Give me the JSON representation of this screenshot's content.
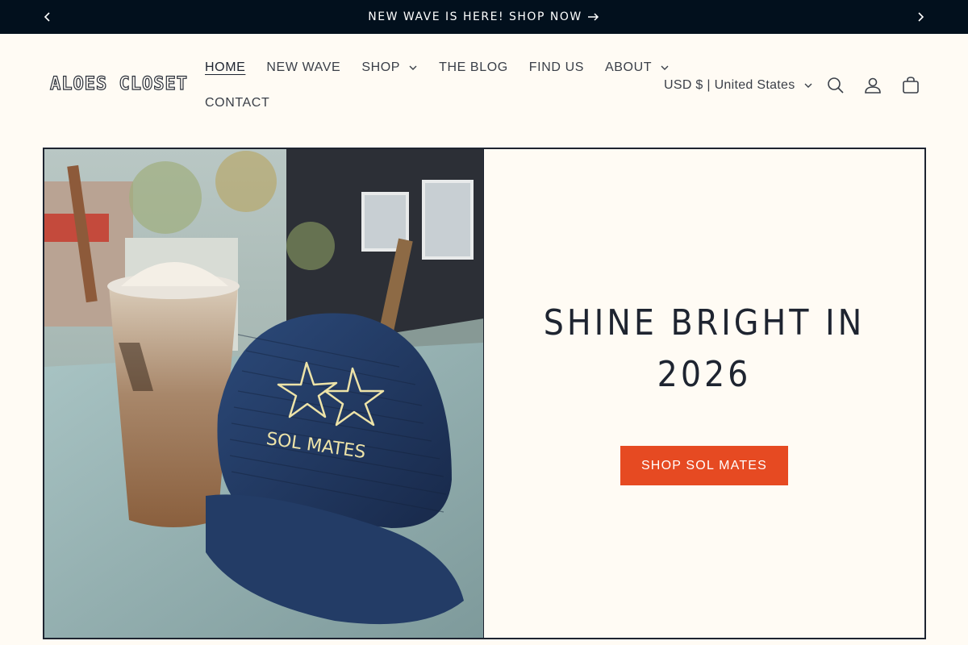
{
  "announcement": {
    "text": "NEW WAVE IS HERE! SHOP NOW",
    "prev_icon": "chevron-left-icon",
    "next_icon": "chevron-right-icon",
    "background": "#02101d"
  },
  "header": {
    "logo_text": "ALOES CLOSET",
    "nav": [
      {
        "label": "HOME",
        "active": true
      },
      {
        "label": "NEW WAVE"
      },
      {
        "label": "SHOP",
        "dropdown": true
      },
      {
        "label": "THE BLOG"
      },
      {
        "label": "FIND US"
      },
      {
        "label": "ABOUT",
        "dropdown": true
      },
      {
        "label": "CONTACT"
      }
    ],
    "locale": "USD $ | United States",
    "icons": [
      "search-icon",
      "account-icon",
      "cart-icon"
    ]
  },
  "hero": {
    "heading": "SHINE BRIGHT IN 2026",
    "button_label": "SHOP SOL MATES",
    "button_color": "#e64a22",
    "image_text": "SOL MATES"
  }
}
